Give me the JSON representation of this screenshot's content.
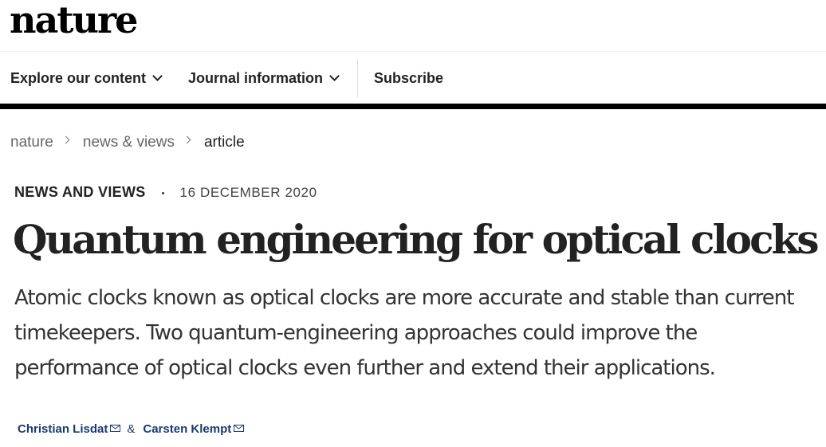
{
  "header": {
    "logo": "nature"
  },
  "nav": {
    "items": [
      {
        "label": "Explore our content"
      },
      {
        "label": "Journal information"
      },
      {
        "label": "Subscribe"
      }
    ]
  },
  "breadcrumb": {
    "items": [
      "nature",
      "news & views",
      "article"
    ]
  },
  "article": {
    "type": "NEWS AND VIEWS",
    "date": "16 DECEMBER 2020",
    "title": "Quantum engineering for optical clocks",
    "standfirst": "Atomic clocks known as optical clocks are more accurate and stable than current timekeepers. Two quantum-engineering approaches could improve the performance of optical clocks even further and extend their applications.",
    "authors": [
      "Christian Lisdat",
      "Carsten Klempt"
    ],
    "author_separator": "&"
  },
  "icons": {
    "nav_dropdown": "chevron-down-icon",
    "breadcrumb_separator": "chevron-right-icon",
    "author_contact": "mail-icon"
  },
  "colors": {
    "text": "#222222",
    "author_link": "#1a3a6e",
    "nav_rule": "#000000"
  }
}
